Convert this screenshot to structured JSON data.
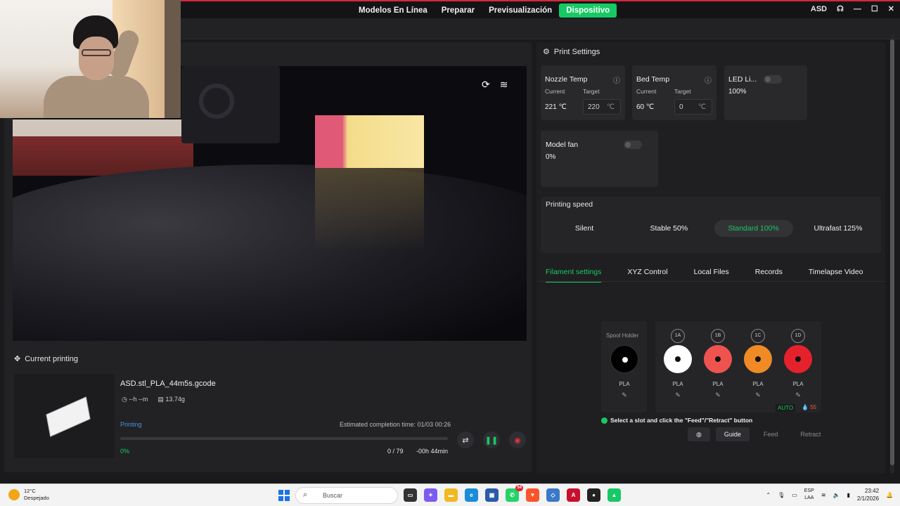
{
  "titlebar": {
    "nav": [
      "Modelos En Línea",
      "Preparar",
      "Previsualización",
      "Dispositivo"
    ],
    "active_nav": "Dispositivo",
    "user": "ASD"
  },
  "camera": {
    "icons": [
      "refresh-icon",
      "wifi-icon"
    ]
  },
  "current_printing": {
    "title": "Current printing",
    "filename": "ASD.stl_PLA_44m5s.gcode",
    "time": "--h --m",
    "weight": "13.74g",
    "status": "Printing",
    "eta": "Estimated completion time: 01/03 00:26",
    "progress_percent": 0,
    "progress_label": "0%",
    "layers": "0 / 79",
    "remaining": "-00h 44min"
  },
  "print_settings": {
    "title": "Print Settings",
    "nozzle": {
      "label": "Nozzle Temp",
      "current_label": "Current",
      "target_label": "Target",
      "current": "221 ℃",
      "target": "220",
      "unit": "℃"
    },
    "bed": {
      "label": "Bed Temp",
      "current_label": "Current",
      "target_label": "Target",
      "current": "60 ℃",
      "target": "0",
      "unit": "℃"
    },
    "led": {
      "label": "LED Li...",
      "value": "100%"
    },
    "fan": {
      "label": "Model fan",
      "value": "0%"
    },
    "speed": {
      "title": "Printing speed",
      "options": [
        "Silent",
        "Stable 50%",
        "Standard 100%",
        "Ultrafast 125%"
      ],
      "selected": "Standard 100%"
    }
  },
  "tabs": [
    "Filament settings",
    "XYZ Control",
    "Local Files",
    "Records",
    "Timelapse Video"
  ],
  "active_tab": "Filament settings",
  "filament": {
    "spool_holder": {
      "label": "Spool Holder",
      "material": "PLA",
      "color": "#000000"
    },
    "slots": [
      {
        "id": "1A",
        "material": "PLA",
        "color": "#ffffff"
      },
      {
        "id": "1B",
        "material": "PLA",
        "color": "#ef5350"
      },
      {
        "id": "1C",
        "material": "PLA",
        "color": "#f08a24"
      },
      {
        "id": "1D",
        "material": "PLA",
        "color": "#e5222c"
      }
    ],
    "auto": "AUTO",
    "humidity": "55",
    "hint": "Select a slot and click the \"Feed\"/\"Retract\" button",
    "buttons": {
      "guide": "Guide",
      "feed": "Feed",
      "retract": "Retract"
    }
  },
  "taskbar": {
    "temp": "12°C",
    "weather": "Despejado",
    "search_placeholder": "Buscar",
    "badge": "54",
    "lang_top": "ESP",
    "lang_bottom": "LAA",
    "time": "23:42",
    "date": "2/1/2026"
  }
}
